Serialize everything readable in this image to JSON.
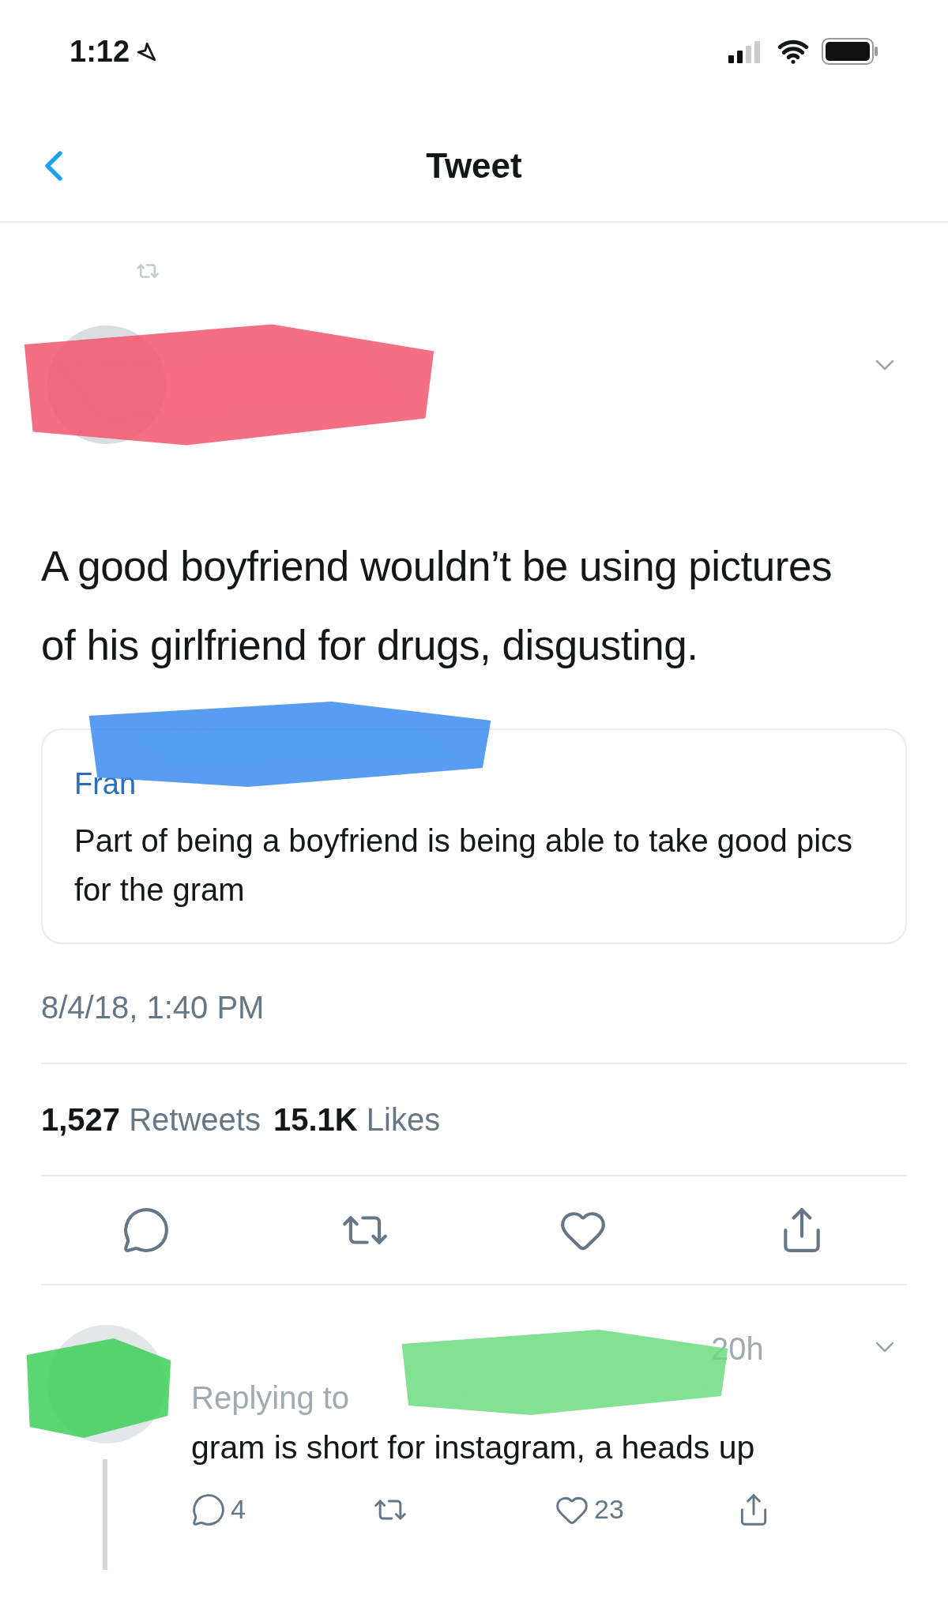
{
  "status_bar": {
    "time": "1:12"
  },
  "nav": {
    "title": "Tweet"
  },
  "tweet": {
    "body": "A good boyfriend wouldn’t be using pictures of his girlfriend for drugs, disgusting.",
    "quoted": {
      "name": "Fran",
      "text": "Part of being a boyfriend is being able to take good pics for the gram"
    },
    "timestamp": "8/4/18, 1:40 PM",
    "stats": [
      {
        "count": "1,527",
        "label": "Retweets"
      },
      {
        "count": "15.1K",
        "label": "Likes"
      }
    ],
    "actions": [
      {
        "kind": "reply"
      },
      {
        "kind": "retweet"
      },
      {
        "kind": "like"
      },
      {
        "kind": "share"
      }
    ]
  },
  "reply": {
    "time": "20h",
    "replying_to": "Replying to",
    "text": "gram is short for instagram, a heads up",
    "actions": [
      {
        "kind": "reply",
        "count": "4"
      },
      {
        "kind": "retweet"
      },
      {
        "kind": "like",
        "count": "23"
      },
      {
        "kind": "share"
      }
    ]
  }
}
